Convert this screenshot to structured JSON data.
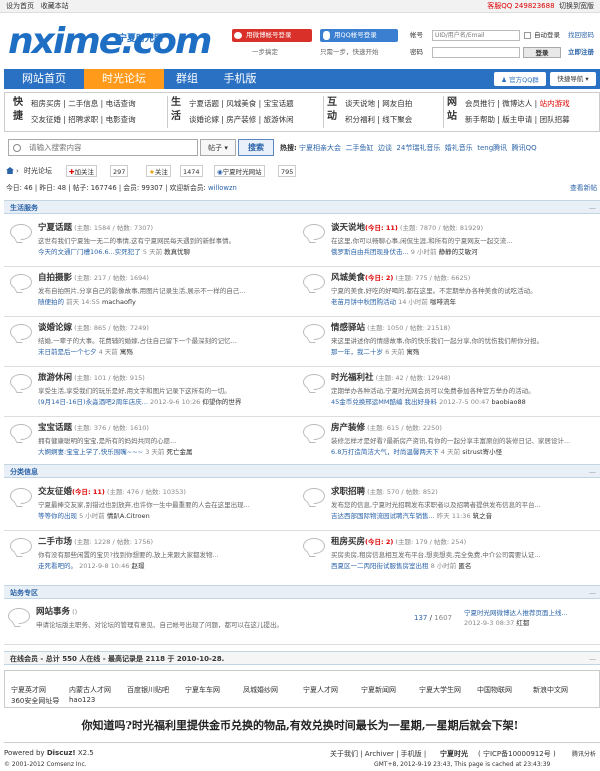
{
  "topbar": {
    "left": [
      "设为首页",
      "收藏本站"
    ],
    "qq": "客服QQ 249823688",
    "switch": "切换到宽版"
  },
  "brand": {
    "logo": "nxime.com",
    "sub": "宁夏时光网"
  },
  "social_login": {
    "weibo": "用微博帐号登录",
    "weibo_sub": "一步搞定",
    "qq": "用QQ帐号登录",
    "qq_sub": "只需一步，快速开始"
  },
  "login": {
    "account_label": "帐号",
    "account_placeholder": "UID/用户名/Email",
    "auto": "自动登录",
    "find": "找回密码",
    "password_label": "密码",
    "login_btn": "登录",
    "register": "立即注册"
  },
  "nav": {
    "items": [
      "网站首页",
      "时光论坛",
      "群组",
      "手机版"
    ],
    "qq_group": "官方QQ群",
    "quick_nav": "快捷导航"
  },
  "quick": {
    "cat1": "快捷",
    "cat2": "生活",
    "cat3": "互动",
    "cat4": "网站",
    "row1a": "租房买房 | 二手信息 | 电话查询",
    "row1b": "交友征婚 | 招聘求职 | 电影查询",
    "row2a": "宁夏话题 | 风城美食 | 宝宝话题",
    "row2b": "谈婚论嫁 | 房产装修 | 旅游休闲",
    "row3a": "谈天说地 | 网友自拍",
    "row3b": "积分福利 | 线下聚会",
    "row4a": "会员推行 | 微博达人 | ",
    "row4a_hl": "站内游戏",
    "row4b": "新手帮助 | 版主申请 | 团队招募"
  },
  "search": {
    "placeholder": "请输入搜索内容",
    "type": "帖子",
    "button": "搜索",
    "hot_label": "热搜:",
    "hot": [
      "宁夏相亲大会",
      "二手鱼缸",
      "边谈",
      "24节瑞礼音乐",
      "婚礼音乐",
      "teng腾讯",
      "腾讯QQ"
    ]
  },
  "breadcrumb": {
    "home": "时光论坛",
    "follow": "加关注",
    "follow_count": "297",
    "fav": "关注",
    "fav_count": "1474",
    "site": "宁夏时光网站",
    "site_count": "795"
  },
  "stats": {
    "text1": "今日: 46",
    "text2": "昨日: 48",
    "text3": "帖子: 167746",
    "text4": "会员: 99307",
    "text5": "欢迎新会员:",
    "newest": "willowzn",
    "view_new": "查看新帖"
  },
  "sections": {
    "life": "生活服务",
    "classified": "分类信息",
    "site": "站务专区"
  },
  "forums": [
    {
      "name": "宁夏话题",
      "meta": " (主题: 1584 / 帖数: 7307)",
      "today": "",
      "desc": "这世有我们宁夏独一无二的事情,这有宁夏网民每天遇到的新鲜事情。",
      "last": "今天的文通厂门槽106.6...实死犯了",
      "time": "5 天前",
      "user": "教真忧聊"
    },
    {
      "name": "谈天说地",
      "meta": " (主题: 7870 / 帖数: 81929)",
      "today": "(今日: 11)",
      "desc": "在这里,你可以畅聊心事,闲侃生涯,和所有的宁夏网友一起交流...",
      "last": "俄罗斯自由兵团现身伏击...",
      "time": "9 小时前",
      "user": "静静的艾敏河"
    },
    {
      "name": "自拍摄影",
      "meta": " (主题: 217 / 帖数: 1694)",
      "today": "",
      "desc": "发布自拍照片,分享自己的影像故事,用图片记录生活,展示不一样的自己...",
      "last": "随便拍的",
      "time": "前天 14:55",
      "user": "machaofly"
    },
    {
      "name": "风城美食",
      "meta": " (主题: 775 / 帖数: 6625)",
      "today": "(今日: 2)",
      "desc": "宁夏的美食,好吃的好喝的,都在这里。不定期举办各种美食的试吃活动。",
      "last": "老苗月饼中秋团购活动",
      "time": "14 小时前",
      "user": "咖啡流年"
    },
    {
      "name": "谈婚论嫁",
      "meta": " (主题: 865 / 帖数: 7249)",
      "today": "",
      "desc": "结婚,一辈子的大事。花费辅的婚嫁,占住自己留下一个最深刻的记忆...",
      "last": "末日前是后一个七夕",
      "time": "4 天前",
      "user": "寓殇"
    },
    {
      "name": "情感驿站",
      "meta": " (主题: 1050 / 帖数: 21518)",
      "today": "",
      "desc": "来这里讲述你的情感故事,你的快乐我们一起分享,你的忧伤我们帮你分担。",
      "last": "那一年，我二十岁",
      "time": "6 天前",
      "user": "寓殇"
    },
    {
      "name": "旅游休闲",
      "meta": " (主题: 101 / 帖数: 915)",
      "today": "",
      "desc": "享受生活,享受我们的玩乐是好,用文字和图片记录下这所有的一切。",
      "last": "(9月14日-16日)永淼酒吧2周年店庆...",
      "time": "2012-9-6 10:26",
      "user": "仰望你的世界"
    },
    {
      "name": "时光福利社",
      "meta": " (主题: 42 / 帖数: 12948)",
      "today": "",
      "desc": "定期举办各种活动,宁夏时光网会员可以免费参加各种官方举办的活动。",
      "last": "45金币兑换邢运MM酷编 我出好身料",
      "time": "2012-7-5 00:47",
      "user": "baobiao88"
    },
    {
      "name": "宝宝话题",
      "meta": " (主题: 376 / 帖数: 1610)",
      "today": "",
      "desc": "拥有健康聪明的宝宝,是所有的妈妈共同的心愿...",
      "last": "大婀婀妻:宝宝上学了,快乐围嘴~~~",
      "time": "3 天前",
      "user": "死亡金属"
    },
    {
      "name": "房产装修",
      "meta": " (主题: 615 / 帖数: 2250)",
      "today": "",
      "desc": "装修怎样才是好看?最新房产资讯,有你的一起分享丰富原创的装修日记、家居设计...",
      "last": "6.8万打造简洁大气，时尚温馨两天下",
      "time": "4 天前",
      "user": "sitrust寄小怪"
    },
    {
      "name": "交友征婚",
      "meta": " (主题: 476 / 帖数: 10353)",
      "today": "(今日: 11)",
      "desc": "宁夏最棒交友家,别错过也别放弃,也许你一生中最重要的人会在这里出现...",
      "last": "等等你的出现",
      "time": "5 小时前",
      "user": "情趴A.Citroen"
    },
    {
      "name": "求职招聘",
      "meta": " (主题: 570 / 帖数: 852)",
      "today": "",
      "desc": "发布您的信息,宁夏时光招聘发布求职者以及招聘者提供发布信息的平台...",
      "last": "吉达西部国际物流园试聘汽车销售...",
      "time": "昨天 11:36",
      "user": "筑之音"
    },
    {
      "name": "二手市场",
      "meta": " (主题: 1228 / 帖数: 1756)",
      "today": "",
      "desc": "你有没有那些闲置的宝贝?找到你想要的,放上来跟大家都发物...",
      "last": "走死看吧的。",
      "time": "2012-9-8 10:46",
      "user": "赵璟"
    },
    {
      "name": "租房买房",
      "meta": " (主题: 179 / 帖数: 254)",
      "today": "(今日: 2)",
      "desc": "买房卖房,租房信息相互发布平台,想卖想卖,完全免费,中介公司需要认证...",
      "last": "西夏区一二丙阳街试服售房室出租",
      "time": "8 小时前",
      "user": "匿名"
    }
  ],
  "site_forum": {
    "name": "网站事务",
    "meta": " ()",
    "desc": "申请论坛版主职务、对论坛的管理有意见、自己帐号出现了问题，都可以在这儿提出。",
    "counts": "137",
    "counts2": "1607",
    "last": "宁夏时光网微博达人推荐页面上线...",
    "time": "2012-9-3 08:37",
    "user": "红都"
  },
  "online": {
    "text": "在线会员 - 总计 550 人在线 - 最高记录是 2118 于 2010-10-28."
  },
  "links": [
    "宁夏英才网",
    "内蒙古人才网",
    "百度银川贴吧",
    "宁夏车车网",
    "凤城婚纱网",
    "宁夏人才网",
    "宁夏新闻网",
    "宁夏大学生网",
    "中国物联网",
    "新浪中文网",
    "360安全网址导",
    "hao123"
  ],
  "ask": "你知道吗?时光福利里提供金币兑换的物品,有效兑换时间最长为一星期,一星期后就会下架!",
  "footer": {
    "powered": "Powered by",
    "discuz": "Discuz!",
    "ver": "X2.5",
    "copy": "© 2001-2012 Comsenz Inc.",
    "links": "关于我们 | Archiver | 手机版 |",
    "site": "宁夏时光",
    "icp": "( 宁ICP备10000912号 )",
    "tencent": "腾讯分析",
    "gmt": "GMT+8, 2012-9-19 23:43, This page is cached at 23:43:39"
  }
}
